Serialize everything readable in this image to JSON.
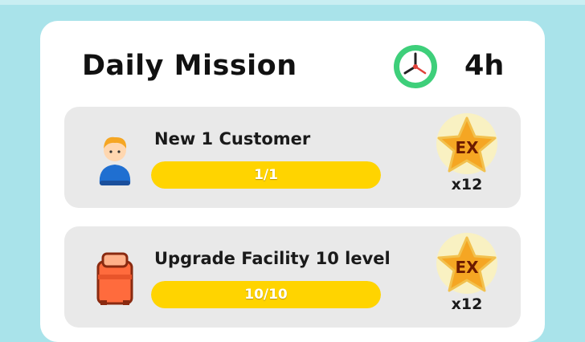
{
  "header": {
    "title": "Daily Mission",
    "timer": "4h"
  },
  "missions": [
    {
      "label": "New 1 Customer",
      "progress_text": "1/1",
      "progress_fraction": 1.0,
      "icon": "customer-icon",
      "reward_label": "EX",
      "reward_count": "x12"
    },
    {
      "label": "Upgrade Facility 10 level",
      "progress_text": "10/10",
      "progress_fraction": 1.0,
      "icon": "bed-icon",
      "reward_label": "EX",
      "reward_count": "x12"
    }
  ],
  "colors": {
    "background": "#a9e3ea",
    "panel": "#ffffff",
    "card": "#e9e9e9",
    "progress_fill": "#ffd400",
    "star": "#f5a623",
    "clock_ring": "#3ecf7a"
  }
}
